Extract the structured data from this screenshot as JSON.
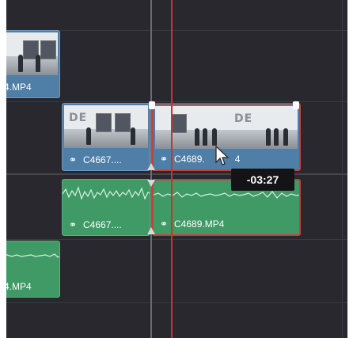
{
  "timeline": {
    "clips": {
      "video_left_partial": "4.MP4",
      "video_a": "C4667....",
      "video_b": "C4689.",
      "video_b_tail": "4",
      "audio_a": "C4667....",
      "audio_b": "C4689.MP4",
      "audio_left_partial": "4.MP4"
    },
    "trim_timecode": "-03:27"
  },
  "icons": {
    "link": "link-icon",
    "cursor": "arrow-cursor-icon",
    "trim": "trim-handle-icon"
  },
  "colors": {
    "video_clip": "#4f7ea6",
    "audio_clip": "#3f9a66",
    "selection": "#c8403a",
    "playhead": "#c0392b",
    "background": "#28282e"
  }
}
